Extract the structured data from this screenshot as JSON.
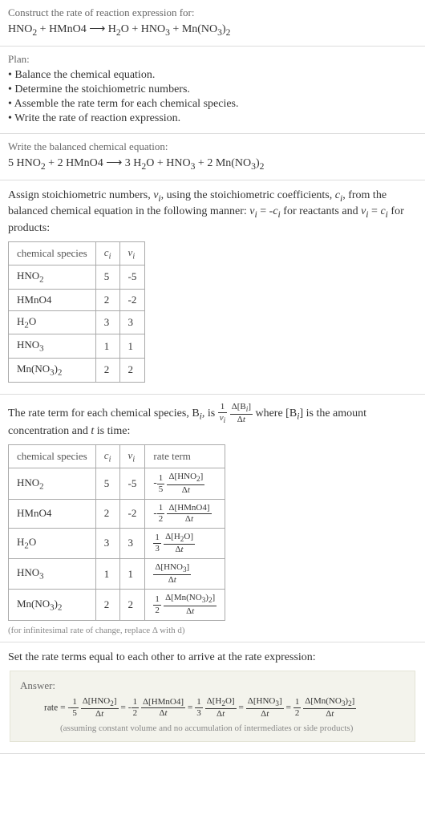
{
  "header": {
    "prompt": "Construct the rate of reaction expression for:",
    "equation_html": "HNO<sub>2</sub> + HMnO4 ⟶ H<sub>2</sub>O + HNO<sub>3</sub> + Mn(NO<sub>3</sub>)<sub>2</sub>"
  },
  "plan": {
    "title": "Plan:",
    "items": [
      "• Balance the chemical equation.",
      "• Determine the stoichiometric numbers.",
      "• Assemble the rate term for each chemical species.",
      "• Write the rate of reaction expression."
    ]
  },
  "balanced": {
    "prompt": "Write the balanced chemical equation:",
    "equation_html": "5 HNO<sub>2</sub> + 2 HMnO4 ⟶ 3 H<sub>2</sub>O + HNO<sub>3</sub> + 2 Mn(NO<sub>3</sub>)<sub>2</sub>"
  },
  "stoich": {
    "intro_html": "Assign stoichiometric numbers, <i>ν<sub>i</sub></i>, using the stoichiometric coefficients, <i>c<sub>i</sub></i>, from the balanced chemical equation in the following manner: <i>ν<sub>i</sub></i> = -<i>c<sub>i</sub></i> for reactants and <i>ν<sub>i</sub></i> = <i>c<sub>i</sub></i> for products:",
    "headers": [
      "chemical species",
      "c_i",
      "ν_i"
    ],
    "rows": [
      {
        "species_html": "HNO<sub>2</sub>",
        "c": "5",
        "nu": "-5"
      },
      {
        "species_html": "HMnO4",
        "c": "2",
        "nu": "-2"
      },
      {
        "species_html": "H<sub>2</sub>O",
        "c": "3",
        "nu": "3"
      },
      {
        "species_html": "HNO<sub>3</sub>",
        "c": "1",
        "nu": "1"
      },
      {
        "species_html": "Mn(NO<sub>3</sub>)<sub>2</sub>",
        "c": "2",
        "nu": "2"
      }
    ]
  },
  "rate_terms": {
    "intro_html": "The rate term for each chemical species, B<sub><i>i</i></sub>, is <span class='frac'><span class='num'>1</span><span class='den'><i>ν<sub>i</sub></i></span></span> <span class='frac'><span class='num'>Δ[B<sub><i>i</i></sub>]</span><span class='den'>Δ<i>t</i></span></span> where [B<sub><i>i</i></sub>] is the amount concentration and <i>t</i> is time:",
    "headers": [
      "chemical species",
      "c_i",
      "ν_i",
      "rate term"
    ],
    "rows": [
      {
        "species_html": "HNO<sub>2</sub>",
        "c": "5",
        "nu": "-5",
        "rate_html": "-<span class='frac'><span class='num'>1</span><span class='den'>5</span></span> <span class='frac'><span class='num'>Δ[HNO<sub>2</sub>]</span><span class='den'>Δ<i>t</i></span></span>"
      },
      {
        "species_html": "HMnO4",
        "c": "2",
        "nu": "-2",
        "rate_html": "-<span class='frac'><span class='num'>1</span><span class='den'>2</span></span> <span class='frac'><span class='num'>Δ[HMnO4]</span><span class='den'>Δ<i>t</i></span></span>"
      },
      {
        "species_html": "H<sub>2</sub>O",
        "c": "3",
        "nu": "3",
        "rate_html": "<span class='frac'><span class='num'>1</span><span class='den'>3</span></span> <span class='frac'><span class='num'>Δ[H<sub>2</sub>O]</span><span class='den'>Δ<i>t</i></span></span>"
      },
      {
        "species_html": "HNO<sub>3</sub>",
        "c": "1",
        "nu": "1",
        "rate_html": "<span class='frac'><span class='num'>Δ[HNO<sub>3</sub>]</span><span class='den'>Δ<i>t</i></span></span>"
      },
      {
        "species_html": "Mn(NO<sub>3</sub>)<sub>2</sub>",
        "c": "2",
        "nu": "2",
        "rate_html": "<span class='frac'><span class='num'>1</span><span class='den'>2</span></span> <span class='frac'><span class='num'>Δ[Mn(NO<sub>3</sub>)<sub>2</sub>]</span><span class='den'>Δ<i>t</i></span></span>"
      }
    ],
    "note": "(for infinitesimal rate of change, replace Δ with d)"
  },
  "final": {
    "prompt": "Set the rate terms equal to each other to arrive at the rate expression:",
    "answer_label": "Answer:",
    "rate_html": "rate = -<span class='frac'><span class='num'>1</span><span class='den'>5</span></span> <span class='frac'><span class='num'>Δ[HNO<sub>2</sub>]</span><span class='den'>Δ<i>t</i></span></span> = -<span class='frac'><span class='num'>1</span><span class='den'>2</span></span> <span class='frac'><span class='num'>Δ[HMnO4]</span><span class='den'>Δ<i>t</i></span></span> = <span class='frac'><span class='num'>1</span><span class='den'>3</span></span> <span class='frac'><span class='num'>Δ[H<sub>2</sub>O]</span><span class='den'>Δ<i>t</i></span></span> = <span class='frac'><span class='num'>Δ[HNO<sub>3</sub>]</span><span class='den'>Δ<i>t</i></span></span> = <span class='frac'><span class='num'>1</span><span class='den'>2</span></span> <span class='frac'><span class='num'>Δ[Mn(NO<sub>3</sub>)<sub>2</sub>]</span><span class='den'>Δ<i>t</i></span></span>",
    "note": "(assuming constant volume and no accumulation of intermediates or side products)"
  }
}
